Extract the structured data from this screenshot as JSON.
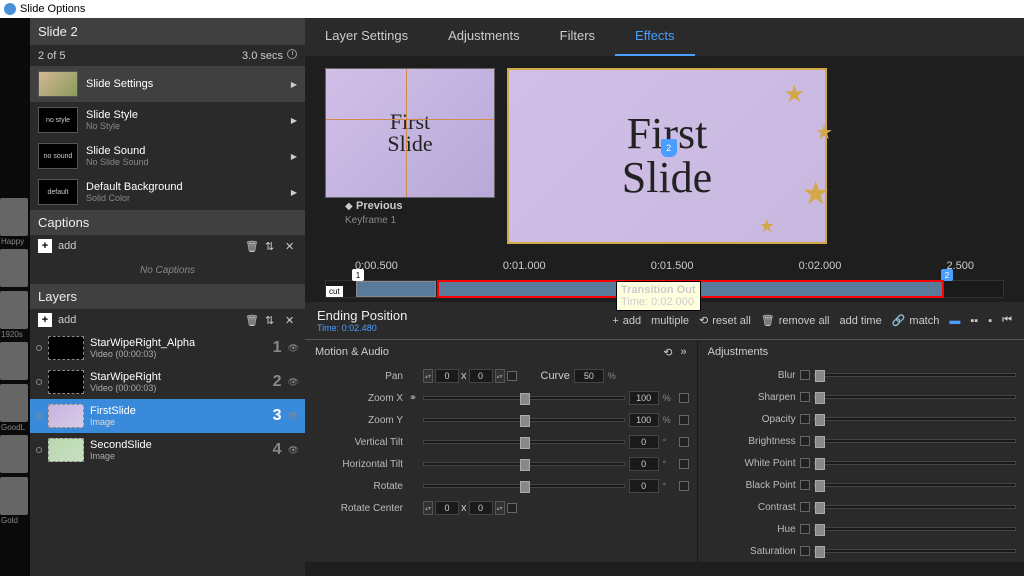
{
  "titlebar": {
    "title": "Slide Options"
  },
  "sidebar": {
    "slide_title": "Slide 2",
    "counter": "2 of 5",
    "duration": "3.0 secs",
    "items": [
      {
        "title": "Slide Settings",
        "sub": "",
        "thumb": "img"
      },
      {
        "title": "Slide Style",
        "sub": "No Style",
        "thumb_text": "no style"
      },
      {
        "title": "Slide Sound",
        "sub": "No Slide Sound",
        "thumb_text": "no sound"
      },
      {
        "title": "Default Background",
        "sub": "Solid Color",
        "thumb_text": "default"
      }
    ],
    "captions_hdr": "Captions",
    "add_label": "add",
    "no_captions": "No Captions",
    "layers_hdr": "Layers"
  },
  "thumbcol": [
    {
      "label": "Happy"
    },
    {
      "label": ""
    },
    {
      "label": "1920s"
    },
    {
      "label": ""
    },
    {
      "label": "GoodL"
    },
    {
      "label": ""
    },
    {
      "label": "Gold"
    }
  ],
  "layers": [
    {
      "title": "StarWipeRight_Alpha",
      "sub": "Video (00:00:03)",
      "num": "1"
    },
    {
      "title": "StarWipeRight",
      "sub": "Video (00:00:03)",
      "num": "2"
    },
    {
      "title": "FirstSlide",
      "sub": "Image",
      "num": "3",
      "selected": true,
      "thumb": "slide1"
    },
    {
      "title": "SecondSlide",
      "sub": "Image",
      "num": "4",
      "thumb": "slide2"
    }
  ],
  "tabs": [
    "Layer Settings",
    "Adjustments",
    "Filters",
    "Effects"
  ],
  "active_tab": 3,
  "preview": {
    "text": "First\nSlide",
    "prev_label": "Previous",
    "keyframe": "Keyframe 1",
    "badge": "2"
  },
  "timeline": {
    "marks": [
      "0:00.500",
      "0:01.000",
      "0:01.500",
      "0:02.000",
      "2.500"
    ],
    "cut": "cut",
    "m1": "1",
    "m2": "2",
    "tooltip_title": "Transition Out",
    "tooltip_time": "Time: 0:02.000"
  },
  "ending": {
    "title": "Ending Position",
    "time": "Time: 0:02.480",
    "tools": [
      "add",
      "multiple",
      "reset all",
      "remove all",
      "add time",
      "match"
    ]
  },
  "motion": {
    "hdr": "Motion & Audio",
    "rows": [
      {
        "label": "Pan",
        "xy": true,
        "x": "0",
        "y": "0",
        "curve_label": "Curve",
        "curve": "50",
        "unit": "%"
      },
      {
        "label": "Zoom X",
        "val": "100",
        "unit": "%",
        "link": true
      },
      {
        "label": "Zoom Y",
        "val": "100",
        "unit": "%"
      },
      {
        "label": "Vertical Tilt",
        "val": "0",
        "unit": "°"
      },
      {
        "label": "Horizontal Tilt",
        "val": "0",
        "unit": "°"
      },
      {
        "label": "Rotate",
        "val": "0",
        "unit": "°"
      },
      {
        "label": "Rotate Center",
        "xy": true,
        "x": "0",
        "y": "0"
      }
    ]
  },
  "adjustments": {
    "hdr": "Adjustments",
    "rows": [
      "Blur",
      "Sharpen",
      "Opacity",
      "Brightness",
      "White Point",
      "Black Point",
      "Contrast",
      "Hue",
      "Saturation"
    ]
  }
}
